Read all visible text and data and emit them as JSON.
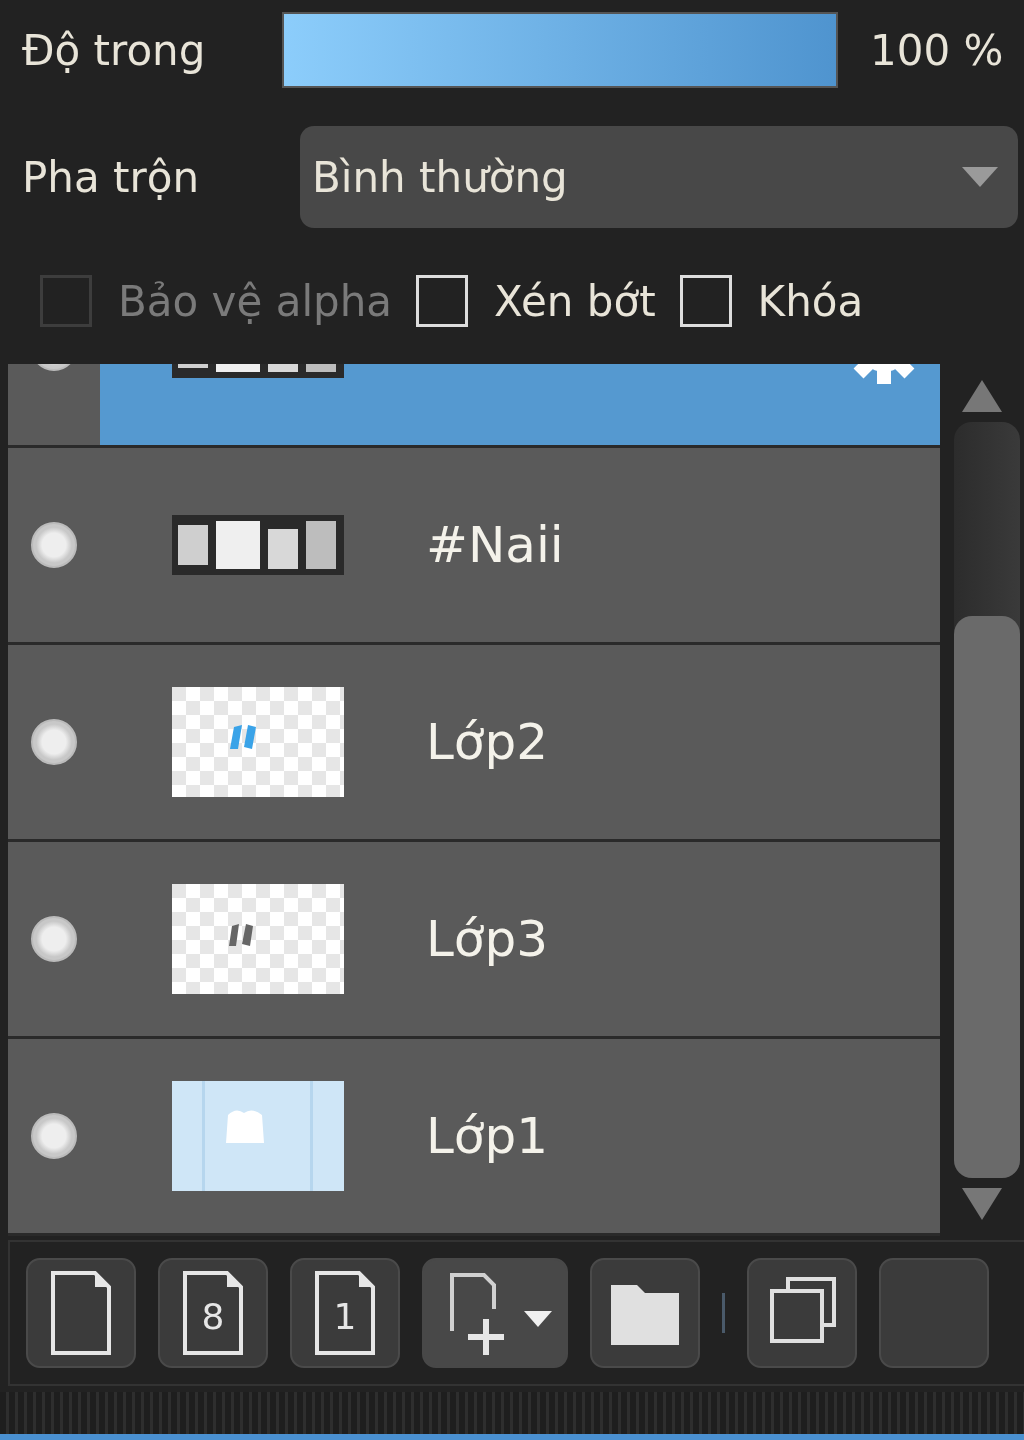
{
  "opacity": {
    "label": "Độ trong",
    "level": 1,
    "reading": "100 %"
  },
  "blend": {
    "label": "Pha trộn",
    "value": "Bình thường"
  },
  "options": [
    {
      "label": "Bảo vệ alpha",
      "checked": false,
      "disabled": true
    },
    {
      "label": "Xén bớt",
      "checked": false,
      "disabled": false
    },
    {
      "label": "Khóa",
      "checked": false,
      "disabled": false
    }
  ],
  "layers": [
    {
      "selected": true,
      "visible": true,
      "kind": "text"
    },
    {
      "name": "#Naii",
      "selected": false,
      "visible": true,
      "kind": "text"
    },
    {
      "name": "Lớp2",
      "selected": false,
      "visible": true,
      "kind": "checker-blue"
    },
    {
      "name": "Lớp3",
      "selected": false,
      "visible": true,
      "kind": "checker-gray"
    },
    {
      "name": "Lớp1",
      "selected": false,
      "visible": true,
      "kind": "pale-blue"
    }
  ],
  "toolbar": [
    {
      "kind": "blank-page"
    },
    {
      "kind": "numbered-page",
      "label": "8"
    },
    {
      "kind": "numbered-page",
      "label": "1"
    },
    {
      "kind": "add-menu"
    },
    {
      "kind": "folder"
    },
    {
      "kind": "separator"
    },
    {
      "kind": "duplicate"
    },
    {
      "kind": "partial"
    }
  ]
}
